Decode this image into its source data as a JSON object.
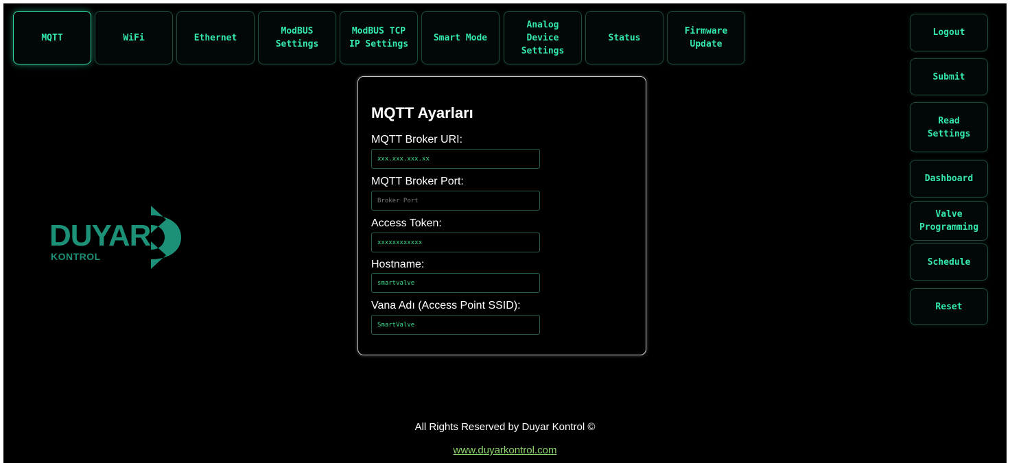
{
  "tabs": [
    {
      "label": "MQTT",
      "active": true
    },
    {
      "label": "WiFi",
      "active": false
    },
    {
      "label": "Ethernet",
      "active": false
    },
    {
      "label": "ModBUS\nSettings",
      "active": false
    },
    {
      "label": "ModBUS TCP\nIP Settings",
      "active": false
    },
    {
      "label": "Smart Mode",
      "active": false
    },
    {
      "label": "Analog\nDevice\nSettings",
      "active": false
    },
    {
      "label": "Status",
      "active": false
    },
    {
      "label": "Firmware\nUpdate",
      "active": false
    }
  ],
  "side_buttons": [
    {
      "label": "Logout"
    },
    {
      "label": "Submit"
    },
    {
      "label": "Read\nSettings"
    },
    {
      "label": "Dashboard"
    },
    {
      "label": "Valve\nProgramming"
    },
    {
      "label": "Schedule"
    },
    {
      "label": "Reset"
    }
  ],
  "logo": {
    "word": "DUYAR",
    "sub": "KONTROL",
    "color": "#1c9178"
  },
  "form": {
    "title": "MQTT Ayarları",
    "fields": [
      {
        "label": "MQTT Broker URI:",
        "value": "xxx.xxx.xxx.xx",
        "placeholder": ""
      },
      {
        "label": "MQTT Broker Port:",
        "value": "",
        "placeholder": "Broker Port"
      },
      {
        "label": "Access Token:",
        "value": "xxxxxxxxxxxx",
        "placeholder": ""
      },
      {
        "label": "Hostname:",
        "value": "smartvalve",
        "placeholder": ""
      },
      {
        "label": "Vana Adı (Access Point SSID):",
        "value": "SmartValve",
        "placeholder": ""
      }
    ]
  },
  "footer": {
    "copyright": "All Rights Reserved by Duyar Kontrol ©",
    "link_text": "www.duyarkontrol.com"
  },
  "colors": {
    "accent": "#35e8b0",
    "background": "#000000",
    "input_text": "#3ee08e",
    "link": "#8fd66d"
  }
}
